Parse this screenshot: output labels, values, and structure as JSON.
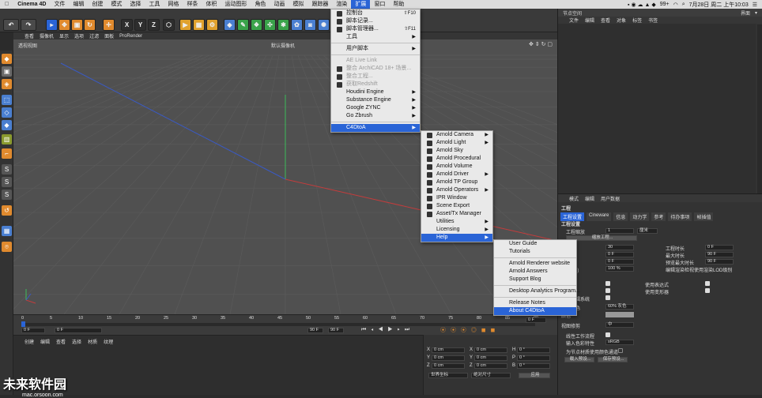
{
  "menubar": {
    "app": "Cinema 4D",
    "items": [
      "文件",
      "编辑",
      "创建",
      "模式",
      "选择",
      "工具",
      "网格",
      "样条",
      "体积",
      "运动图形",
      "角色",
      "动画",
      "模拟",
      "跟踪器",
      "渲染",
      "扩展",
      "窗口",
      "帮助"
    ],
    "active_index": 15,
    "status_right": "99+",
    "clock": "7月28日 周二 上午10:03"
  },
  "toolbar_axes": [
    "X",
    "Y",
    "Z"
  ],
  "viewport": {
    "menu": [
      "查看",
      "摄像机",
      "显示",
      "选项",
      "过滤",
      "面板",
      "ProRender"
    ],
    "title": "透视视图",
    "camera": "默认摄像机"
  },
  "timeline": {
    "ticks": [
      "0",
      "5",
      "10",
      "15",
      "20",
      "25",
      "30",
      "35",
      "40",
      "45",
      "50",
      "55",
      "60",
      "65",
      "70",
      "75",
      "80",
      "85",
      "90"
    ],
    "start_frame": "0 F",
    "current_frame": "0 F",
    "end_frame": "90 F",
    "end_frame2": "90 F",
    "frame_readout": "0 F"
  },
  "materials": {
    "menu": [
      "创建",
      "编辑",
      "查看",
      "选择",
      "材质",
      "纹理"
    ]
  },
  "coords": {
    "rows": [
      {
        "axis": "X",
        "v1": "0 cm",
        "axis2": "X",
        "v2": "0 cm",
        "axis3": "H",
        "v3": "0 °"
      },
      {
        "axis": "Y",
        "v1": "0 cm",
        "axis2": "Y",
        "v2": "0 cm",
        "axis3": "P",
        "v3": "0 °"
      },
      {
        "axis": "Z",
        "v1": "0 cm",
        "axis2": "Z",
        "v2": "0 cm",
        "axis3": "B",
        "v3": "0 °"
      }
    ],
    "mode1": "世界坐标",
    "mode2": "绝对尺寸",
    "apply": "应用"
  },
  "objects_panel": {
    "title_left": "节点空间",
    "title_right": "界面",
    "tabs": [
      "文件",
      "编辑",
      "查看",
      "对象",
      "标签",
      "书签"
    ]
  },
  "attributes": {
    "header": [
      "模式",
      "编辑",
      "用户数据"
    ],
    "section": "工程",
    "tabs": [
      "工程设置",
      "Cineware",
      "信息",
      "动力学",
      "参考",
      "待办事项",
      "帧插值"
    ],
    "selected_tab": 0,
    "group": "工程设置",
    "scale_label": "工程缩放",
    "scale_value": "1",
    "scale_unit": "厘米",
    "scale_button": "缩放工程...",
    "fields": [
      {
        "label": "FPS)",
        "value": "30",
        "label2": "工程时长",
        "value2": "0 F"
      },
      {
        "label": "长",
        "value": "0 F",
        "label2": "最大时长",
        "value2": "90 F"
      },
      {
        "label": "小时长",
        "value": "0 F",
        "label2": "预览最大时长",
        "value2": "90 F"
      },
      {
        "label": "度(LOD)",
        "value": "100 %",
        "label2": "编辑渲染检视使用渲染LOD级别",
        "value2": ""
      }
    ],
    "checks": [
      {
        "label": "表达",
        "label2": "使用表达式"
      },
      {
        "label": "生成器",
        "label2": "使用变形器"
      },
      {
        "label": "运动剪辑系统",
        "label2": ""
      }
    ],
    "color_label": "对象颜色",
    "color_value": "60% 灰色",
    "color2_label": "颜色",
    "view_clip_label": "视图修剪",
    "view_clip_value": "中",
    "linear_label": "线性工作流程",
    "input_color_label": "输入色彩特性",
    "input_color_value": "sRGB",
    "node_label": "为节点材质使用颜色通道",
    "load_preset": "载入预设...",
    "save_preset": "保存预设..."
  },
  "menus": {
    "extensions": [
      {
        "label": "控制台",
        "shortcut": "⇧F10",
        "icon": true
      },
      {
        "label": "脚本记录...",
        "icon": true
      },
      {
        "label": "脚本管理器...",
        "shortcut": "⇧F11",
        "icon": true
      },
      {
        "label": "工具",
        "arrow": true
      },
      {
        "sep": true
      },
      {
        "label": "用户脚本",
        "arrow": true
      },
      {
        "sep": true
      },
      {
        "label": "AE Live Link",
        "disabled": true
      },
      {
        "label": "整合 ArchiCAD 18+ 场景...",
        "disabled": true,
        "icon": true
      },
      {
        "label": "整合工程...",
        "disabled": true,
        "icon": true
      },
      {
        "label": "获取Redshift",
        "disabled": true,
        "icon": true
      },
      {
        "label": "Houdini Engine",
        "arrow": true
      },
      {
        "label": "Substance Engine",
        "arrow": true
      },
      {
        "label": "Google ZYNC",
        "arrow": true
      },
      {
        "label": "Go Zbrush",
        "arrow": true
      },
      {
        "sep": true
      },
      {
        "label": "C4DtoA",
        "arrow": true,
        "highlight": true
      }
    ],
    "c4dtoa": [
      {
        "label": "Arnold Camera",
        "arrow": true,
        "icon": true
      },
      {
        "label": "Arnold Light",
        "arrow": true,
        "icon": true
      },
      {
        "label": "Arnold Sky",
        "icon": true
      },
      {
        "label": "Arnold Procedural",
        "icon": true
      },
      {
        "label": "Arnold Volume",
        "icon": true
      },
      {
        "label": "Arnold Driver",
        "arrow": true,
        "icon": true
      },
      {
        "label": "Arnold TP Group",
        "icon": true
      },
      {
        "label": "Arnold Operators",
        "arrow": true,
        "icon": true
      },
      {
        "label": "IPR Window",
        "icon": true
      },
      {
        "label": "Scene Export",
        "icon": true
      },
      {
        "label": "Asset/Tx Manager",
        "icon": true
      },
      {
        "label": "Utilities",
        "arrow": true
      },
      {
        "label": "Licensing",
        "arrow": true
      },
      {
        "label": "Help",
        "arrow": true,
        "highlight": true
      }
    ],
    "help": [
      {
        "label": "User Guide"
      },
      {
        "label": "Tutorials"
      },
      {
        "sep": true
      },
      {
        "label": "Arnold Renderer website"
      },
      {
        "label": "Arnold Answers"
      },
      {
        "label": "Support Blog"
      },
      {
        "sep": true
      },
      {
        "label": "Desktop Analytics Program..."
      },
      {
        "sep": true
      },
      {
        "label": "Release Notes"
      },
      {
        "label": "About C4DtoA",
        "highlight": true
      }
    ]
  },
  "watermark": {
    "title": "未来软件园",
    "url": "mac.orsoon.com"
  },
  "colors": {
    "accent": "#2a64d6",
    "viewport": "#505050",
    "panel": "#333333"
  }
}
